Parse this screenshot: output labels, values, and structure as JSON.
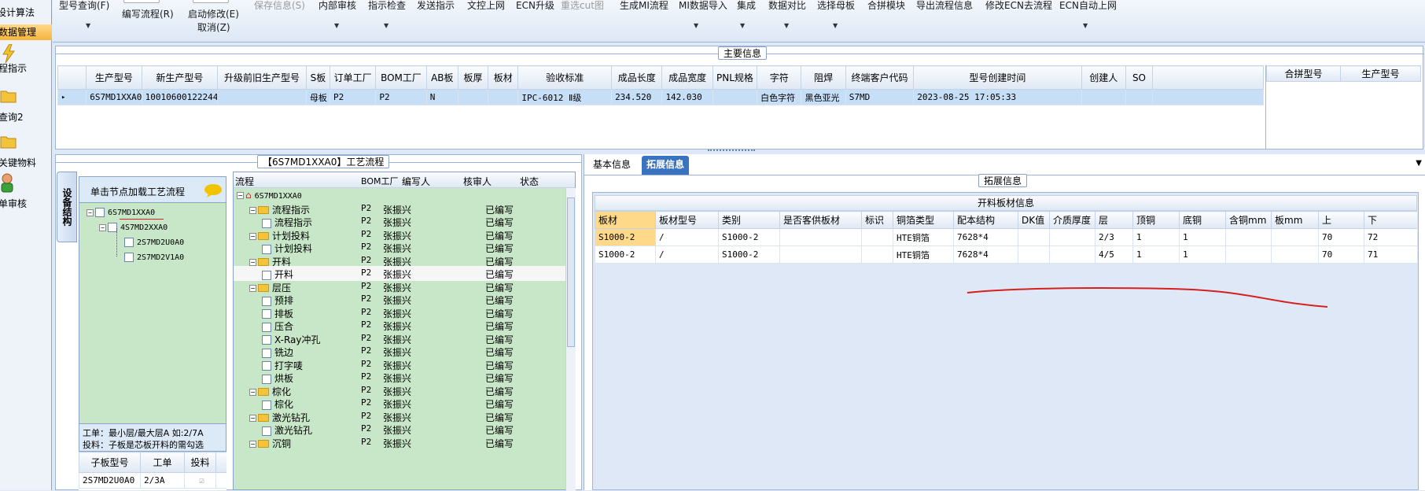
{
  "leftnav": {
    "items": [
      {
        "label": "设计算法",
        "selected": false
      },
      {
        "label": "数据管理",
        "selected": true
      },
      {
        "label": "程指示",
        "icon": "lightning-icon"
      },
      {
        "label": "查询2",
        "icon": "folder-icon"
      },
      {
        "label": "关键物料",
        "icon": "folder-icon"
      },
      {
        "label": "单审核",
        "icon": "user-icon"
      }
    ]
  },
  "toolbar": {
    "items": [
      {
        "label": "型号查询(F)",
        "disabled": false,
        "dropdown": true
      },
      {
        "label": "编写流程(R)",
        "disabled": false,
        "dropdown": false
      },
      {
        "label": "启动修改(E)",
        "disabled": false,
        "dropdown": false
      },
      {
        "label": "取消(Z)",
        "disabled": false,
        "dropdown": false
      },
      {
        "label": "保存信息(S)",
        "disabled": true,
        "dropdown": false
      },
      {
        "label": "内部审核",
        "disabled": false,
        "dropdown": true
      },
      {
        "label": "指示检查",
        "disabled": false,
        "dropdown": true
      },
      {
        "label": "发送指示",
        "disabled": false,
        "dropdown": false
      },
      {
        "label": "文控上网",
        "disabled": false,
        "dropdown": false
      },
      {
        "label": "ECN升级",
        "disabled": false,
        "dropdown": false
      },
      {
        "label": "重选cut图",
        "disabled": true,
        "dropdown": false
      },
      {
        "label": "生成MI流程",
        "disabled": false,
        "dropdown": false
      },
      {
        "label": "MI数据导入",
        "disabled": false,
        "dropdown": true
      },
      {
        "label": "集成",
        "disabled": false,
        "dropdown": true
      },
      {
        "label": "数据对比",
        "disabled": false,
        "dropdown": true
      },
      {
        "label": "选择母板",
        "disabled": false,
        "dropdown": true
      },
      {
        "label": "合拼模块",
        "disabled": false,
        "dropdown": false
      },
      {
        "label": "导出流程信息",
        "disabled": false,
        "dropdown": false
      },
      {
        "label": "修改ECN去流程",
        "disabled": false,
        "dropdown": false
      },
      {
        "label": "ECN自动上网",
        "disabled": false,
        "dropdown": true
      }
    ]
  },
  "main_info": {
    "title": "主要信息",
    "columns": [
      "生产型号",
      "新生产型号",
      "升级前旧生产型号",
      "S板",
      "订单工厂",
      "BOM工厂",
      "AB板",
      "板厚",
      "板材",
      "验收标准",
      "成品长度",
      "成品宽度",
      "PNL规格",
      "字符",
      "阻焊",
      "终端客户代码",
      "型号创建时间",
      "创建人",
      "SO"
    ],
    "rows": [
      [
        "6S7MD1XXA0",
        "10010600122244",
        "",
        "母板",
        "P2",
        "P2",
        "N",
        "",
        "",
        "IPC-6012 Ⅱ级",
        "234.520",
        "142.030",
        "",
        "白色字符",
        "黑色亚光",
        "S7MD",
        "2023-08-25 17:05:33",
        "",
        ""
      ]
    ],
    "side_columns": [
      "合拼型号",
      "生产型号"
    ]
  },
  "process": {
    "title": "【6S7MD1XXA0】工艺流程",
    "vertical_tab": "设备结构",
    "tree_header": "单击节点加载工艺流程",
    "tree": [
      {
        "label": "6S7MD1XXA0",
        "level": 0
      },
      {
        "label": "4S7MD2XXA0",
        "level": 1
      },
      {
        "label": "2S7MD2U0A0",
        "level": 2
      },
      {
        "label": "2S7MD2V1A0",
        "level": 2
      }
    ],
    "note_line1": "工单：最小层/最大层A 如:2/7A",
    "note_line2": "投料：子板是芯板开料的需勾选",
    "sub_columns": [
      "子板型号",
      "工单",
      "投料"
    ],
    "sub_rows": [
      [
        "2S7MD2U0A0",
        "2/3A",
        "☑"
      ]
    ],
    "flow_columns": [
      "流程",
      "BOM工厂",
      "编写人",
      "核审人",
      "状态"
    ],
    "flow_rows": [
      {
        "name": "6S7MD1XXA0",
        "type": "root",
        "factory": "",
        "writer": "",
        "reviewer": "",
        "status": ""
      },
      {
        "name": "流程指示",
        "type": "folder",
        "factory": "P2",
        "writer": "张振兴",
        "reviewer": "",
        "status": "已编写"
      },
      {
        "name": "流程指示",
        "type": "file",
        "factory": "P2",
        "writer": "张振兴",
        "reviewer": "",
        "status": "已编写"
      },
      {
        "name": "计划投料",
        "type": "folder",
        "factory": "P2",
        "writer": "张振兴",
        "reviewer": "",
        "status": "已编写"
      },
      {
        "name": "计划投料",
        "type": "file",
        "factory": "P2",
        "writer": "张振兴",
        "reviewer": "",
        "status": "已编写"
      },
      {
        "name": "开料",
        "type": "folder",
        "factory": "P2",
        "writer": "张振兴",
        "reviewer": "",
        "status": "已编写"
      },
      {
        "name": "开料",
        "type": "file",
        "factory": "P2",
        "writer": "张振兴",
        "reviewer": "",
        "status": "已编写",
        "selected": true
      },
      {
        "name": "层压",
        "type": "folder",
        "factory": "P2",
        "writer": "张振兴",
        "reviewer": "",
        "status": "已编写"
      },
      {
        "name": "预排",
        "type": "file",
        "factory": "P2",
        "writer": "张振兴",
        "reviewer": "",
        "status": "已编写"
      },
      {
        "name": "排板",
        "type": "file",
        "factory": "P2",
        "writer": "张振兴",
        "reviewer": "",
        "status": "已编写"
      },
      {
        "name": "压合",
        "type": "file",
        "factory": "P2",
        "writer": "张振兴",
        "reviewer": "",
        "status": "已编写"
      },
      {
        "name": "X-Ray冲孔",
        "type": "file",
        "factory": "P2",
        "writer": "张振兴",
        "reviewer": "",
        "status": "已编写"
      },
      {
        "name": "铣边",
        "type": "file",
        "factory": "P2",
        "writer": "张振兴",
        "reviewer": "",
        "status": "已编写"
      },
      {
        "name": "打字唛",
        "type": "file",
        "factory": "P2",
        "writer": "张振兴",
        "reviewer": "",
        "status": "已编写"
      },
      {
        "name": "烘板",
        "type": "file",
        "factory": "P2",
        "writer": "张振兴",
        "reviewer": "",
        "status": "已编写"
      },
      {
        "name": "棕化",
        "type": "folder",
        "factory": "P2",
        "writer": "张振兴",
        "reviewer": "",
        "status": "已编写"
      },
      {
        "name": "棕化",
        "type": "file",
        "factory": "P2",
        "writer": "张振兴",
        "reviewer": "",
        "status": "已编写"
      },
      {
        "name": "激光钻孔",
        "type": "folder",
        "factory": "P2",
        "writer": "张振兴",
        "reviewer": "",
        "status": "已编写"
      },
      {
        "name": "激光钻孔",
        "type": "file",
        "factory": "P2",
        "writer": "张振兴",
        "reviewer": "",
        "status": "已编写"
      },
      {
        "name": "沉铜",
        "type": "folder",
        "factory": "P2",
        "writer": "张振兴",
        "reviewer": "",
        "status": "已编写"
      }
    ]
  },
  "right": {
    "tabs": [
      {
        "label": "基本信息",
        "active": false
      },
      {
        "label": "拓展信息",
        "active": true
      }
    ],
    "section_title": "拓展信息",
    "table_title": "开料板材信息",
    "columns": [
      "板材",
      "板材型号",
      "类别",
      "是否客供板材",
      "标识",
      "铜箔类型",
      "配本结构",
      "DK值",
      "介质厚度",
      "层",
      "顶铜",
      "底铜",
      "含铜mm",
      "板mm",
      "上",
      "下"
    ],
    "rows": [
      [
        "S1000-2",
        "/",
        "S1000-2",
        "",
        "",
        "HTE铜箔",
        "7628*4",
        "",
        "",
        "2/3",
        "1",
        "1",
        "",
        "",
        "70",
        "72"
      ],
      [
        "S1000-2",
        "/",
        "S1000-2",
        "",
        "",
        "HTE铜箔",
        "7628*4",
        "",
        "",
        "4/5",
        "1",
        "1",
        "",
        "",
        "70",
        "71"
      ]
    ],
    "annotation_color": "#d42020"
  }
}
